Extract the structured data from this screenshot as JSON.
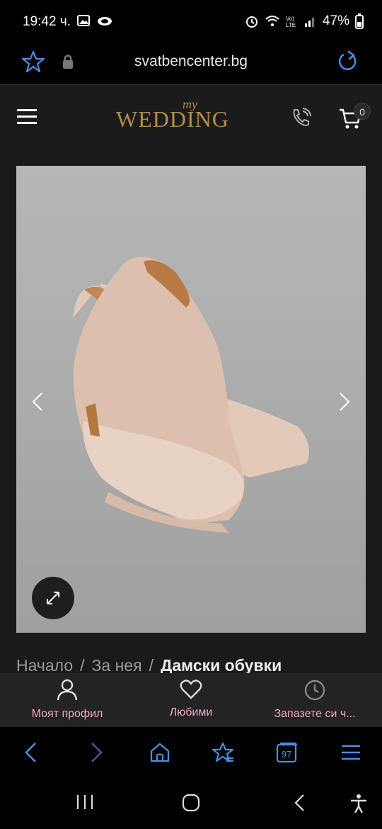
{
  "status_bar": {
    "time": "19:42 ч.",
    "battery": "47%"
  },
  "browser": {
    "url": "svatbencenter.bg",
    "tab_count": "97"
  },
  "site": {
    "cart_count": "0",
    "logo_my": "my",
    "logo_word": "WEDDING"
  },
  "breadcrumb": {
    "items": [
      "Начало",
      "За нея",
      "Дамски обувки"
    ]
  },
  "site_nav": {
    "profile": "Моят профил",
    "favorites": "Любими",
    "book": "Запазете си ч..."
  },
  "colors": {
    "accent_blue": "#4a8fe7",
    "logo_gold": "#b38d4a",
    "nav_pink": "#f3a6c6",
    "image_bg": "#a3a3a3"
  }
}
